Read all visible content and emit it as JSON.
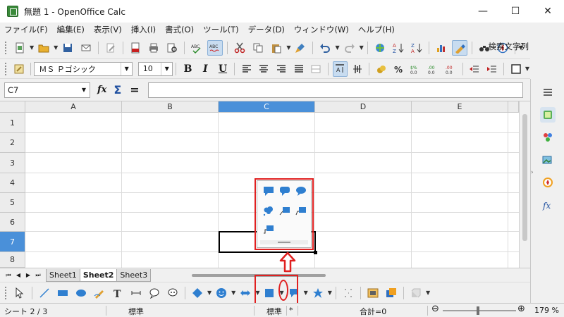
{
  "window": {
    "title": "無題 1 - OpenOffice Calc",
    "minimize": "—",
    "maximize": "☐",
    "close": "✕"
  },
  "menu": [
    "ファイル(F)",
    "編集(E)",
    "表示(V)",
    "挿入(I)",
    "書式(O)",
    "ツール(T)",
    "データ(D)",
    "ウィンドウ(W)",
    "ヘルプ(H)"
  ],
  "toolbar": {
    "search_label": "検索文字列"
  },
  "format": {
    "font_name": "ＭＳ Ｐゴシック",
    "font_size": "10",
    "bold": "B",
    "italic": "I",
    "underline": "U"
  },
  "formula": {
    "cell_ref": "C7",
    "fx": "fx",
    "sigma": "Σ",
    "equals": "="
  },
  "grid": {
    "columns": [
      "A",
      "B",
      "C",
      "D",
      "E"
    ],
    "rows": [
      "1",
      "2",
      "3",
      "4",
      "5",
      "6",
      "7",
      "8"
    ],
    "selected_column": "C",
    "selected_row": "7"
  },
  "sheets": {
    "tabs": [
      "Sheet1",
      "Sheet2",
      "Sheet3"
    ],
    "active": "Sheet2"
  },
  "status": {
    "sheet": "シート 2 / 3",
    "style": "標準",
    "mode": "標準",
    "modified": "*",
    "sum": "合計=0",
    "zoom": "179 %"
  },
  "colors": {
    "highlight": "#e02020",
    "selection": "#4a90d9",
    "callout": "#2f7fd0"
  }
}
